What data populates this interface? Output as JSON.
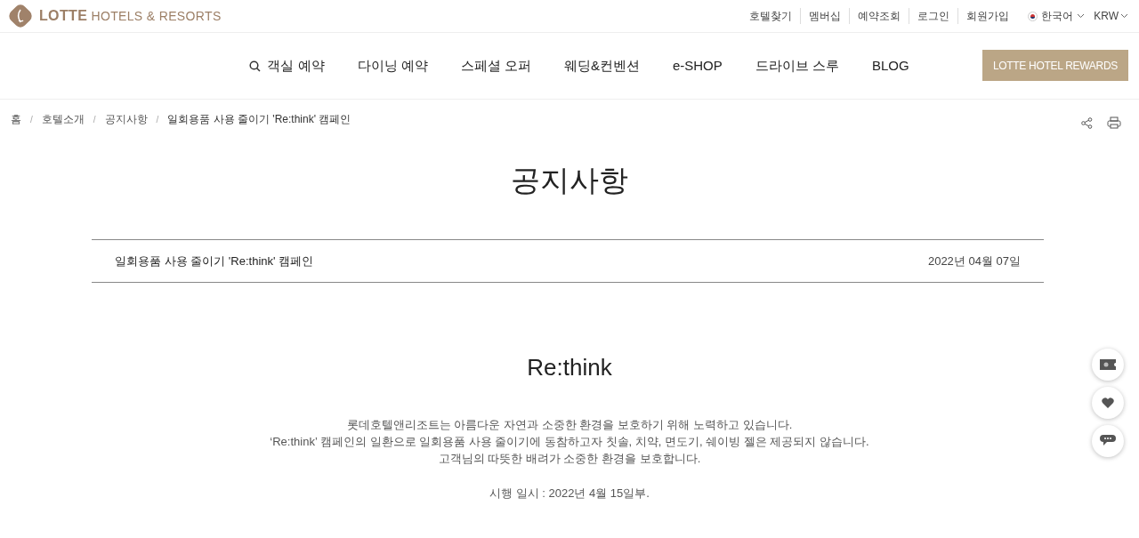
{
  "logo": {
    "brand": "LOTTE",
    "tagline": "HOTELS & RESORTS"
  },
  "utility_links": [
    "호텔찾기",
    "멤버십",
    "예약조회",
    "로그인",
    "회원가입"
  ],
  "language": "한국어",
  "currency": "KRW",
  "nav": [
    {
      "label": "객실 예약",
      "kind": "search"
    },
    {
      "label": "다이닝 예약",
      "kind": "link"
    },
    {
      "label": "스페셜 오퍼",
      "kind": "link"
    },
    {
      "label": "웨딩&컨벤션",
      "kind": "link"
    },
    {
      "label": "e-SHOP",
      "kind": "link"
    },
    {
      "label": "드라이브 스루",
      "kind": "link"
    },
    {
      "label": "BLOG",
      "kind": "link"
    }
  ],
  "rewards_button": "LOTTE HOTEL REWARDS",
  "breadcrumb": {
    "separator": "/",
    "items": [
      "홈",
      "호텔소개",
      "공지사항",
      "일회용품 사용 줄이기 'Re:think' 캠페인"
    ]
  },
  "page_title": "공지사항",
  "notice": {
    "title": "일회용품 사용 줄이기 'Re:think' 캠페인",
    "date": "2022년 04월 07일"
  },
  "article": {
    "heading": "Re:think",
    "paragraphs": [
      "롯데호텔앤리조트는 아름다운 자연과 소중한 환경을 보호하기 위해 노력하고 있습니다.",
      "‘Re:think’ 캠페인의 일환으로 일회용품 사용 줄이기에 동참하고자 칫솔, 치약, 면도기, 쉐이빙 젤은 제공되지 않습니다.",
      "고객님의 따뜻한 배려가 소중한 환경을 보호합니다."
    ],
    "note": "시행 일시 : 2022년 4월 15일부."
  }
}
